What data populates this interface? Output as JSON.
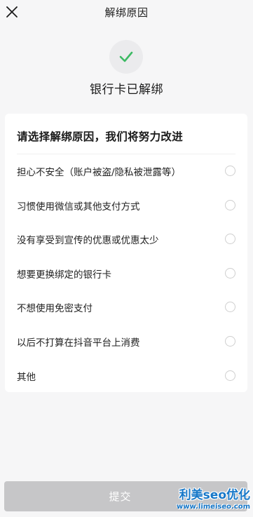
{
  "header": {
    "title": "解绑原因",
    "close_icon": "close-icon"
  },
  "status": {
    "icon": "check-icon",
    "icon_color": "#3dba64",
    "message": "银行卡已解绑"
  },
  "card": {
    "heading": "请选择解绑原因，我们将努力改进",
    "reasons": [
      {
        "label": "担心不安全（账户被盗/隐私被泄露等）",
        "selected": false
      },
      {
        "label": "习惯使用微信或其他支付方式",
        "selected": false
      },
      {
        "label": "没有享受到宣传的优惠或优惠太少",
        "selected": false
      },
      {
        "label": "想要更换绑定的银行卡",
        "selected": false
      },
      {
        "label": "不想使用免密支付",
        "selected": false
      },
      {
        "label": "以后不打算在抖音平台上消费",
        "selected": false
      },
      {
        "label": "其他",
        "selected": false
      }
    ]
  },
  "footer": {
    "submit_label": "提交",
    "submit_disabled": true
  },
  "watermark": {
    "main": "利美seo优化",
    "sub": "www.limeiseo.com",
    "color": "#1677c8"
  }
}
